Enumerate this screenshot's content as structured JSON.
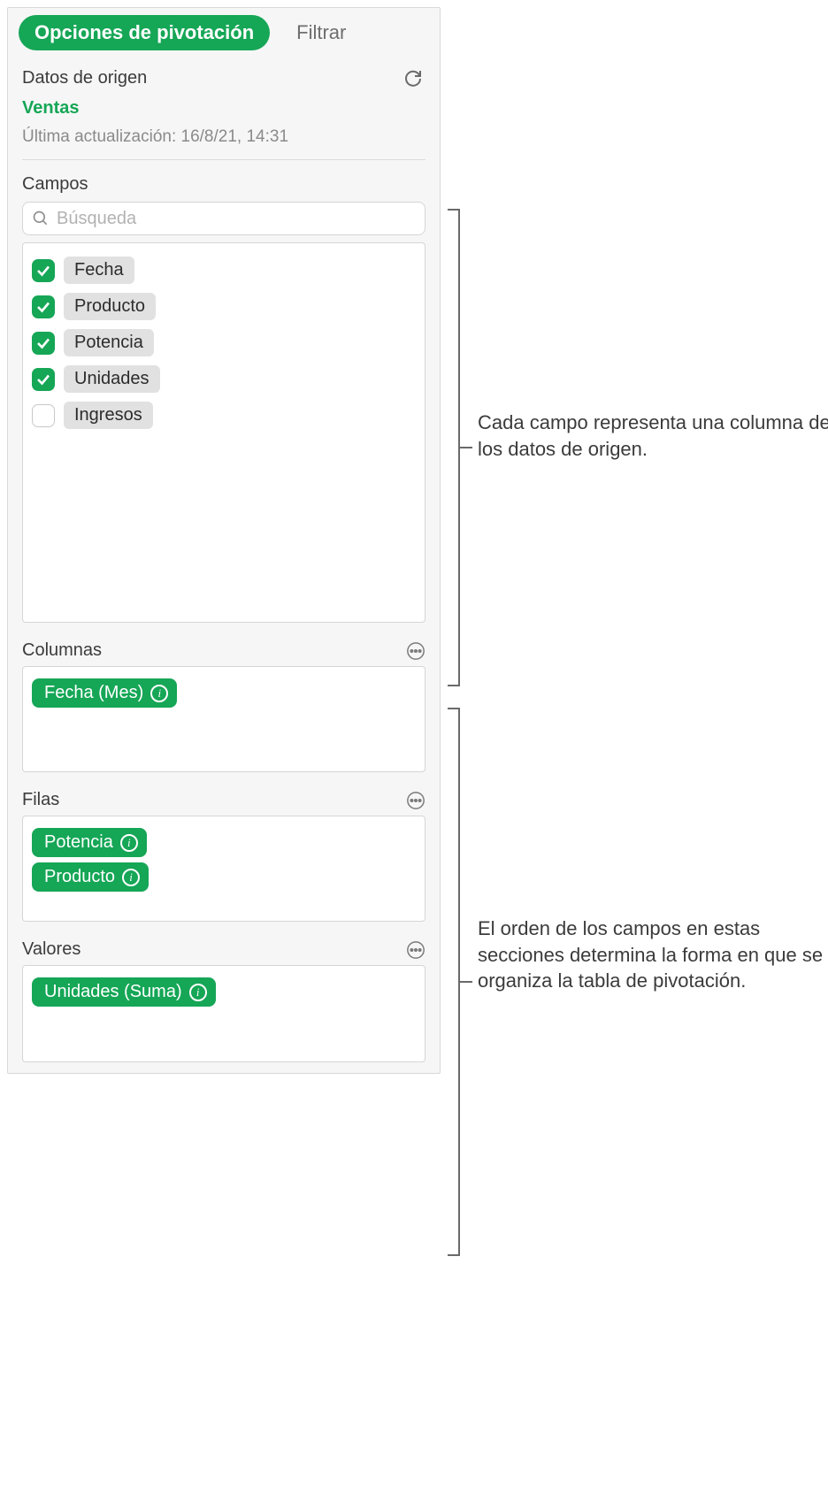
{
  "tabs": {
    "active": "Opciones de pivotación",
    "inactive": "Filtrar"
  },
  "source": {
    "title": "Datos de origen",
    "name": "Ventas",
    "updated": "Última actualización: 16/8/21, 14:31"
  },
  "fieldsSection": {
    "label": "Campos",
    "searchPlaceholder": "Búsqueda",
    "items": [
      {
        "label": "Fecha",
        "checked": true
      },
      {
        "label": "Producto",
        "checked": true
      },
      {
        "label": "Potencia",
        "checked": true
      },
      {
        "label": "Unidades",
        "checked": true
      },
      {
        "label": "Ingresos",
        "checked": false
      }
    ]
  },
  "zones": {
    "columns": {
      "title": "Columnas",
      "items": [
        "Fecha (Mes)"
      ]
    },
    "rows": {
      "title": "Filas",
      "items": [
        "Potencia",
        "Producto"
      ]
    },
    "values": {
      "title": "Valores",
      "items": [
        "Unidades (Suma)"
      ]
    }
  },
  "callouts": {
    "top": "Cada campo representa una columna de los datos de origen.",
    "bottom": "El orden de los campos en estas secciones determina la forma en que se organiza la tabla de pivotación."
  }
}
